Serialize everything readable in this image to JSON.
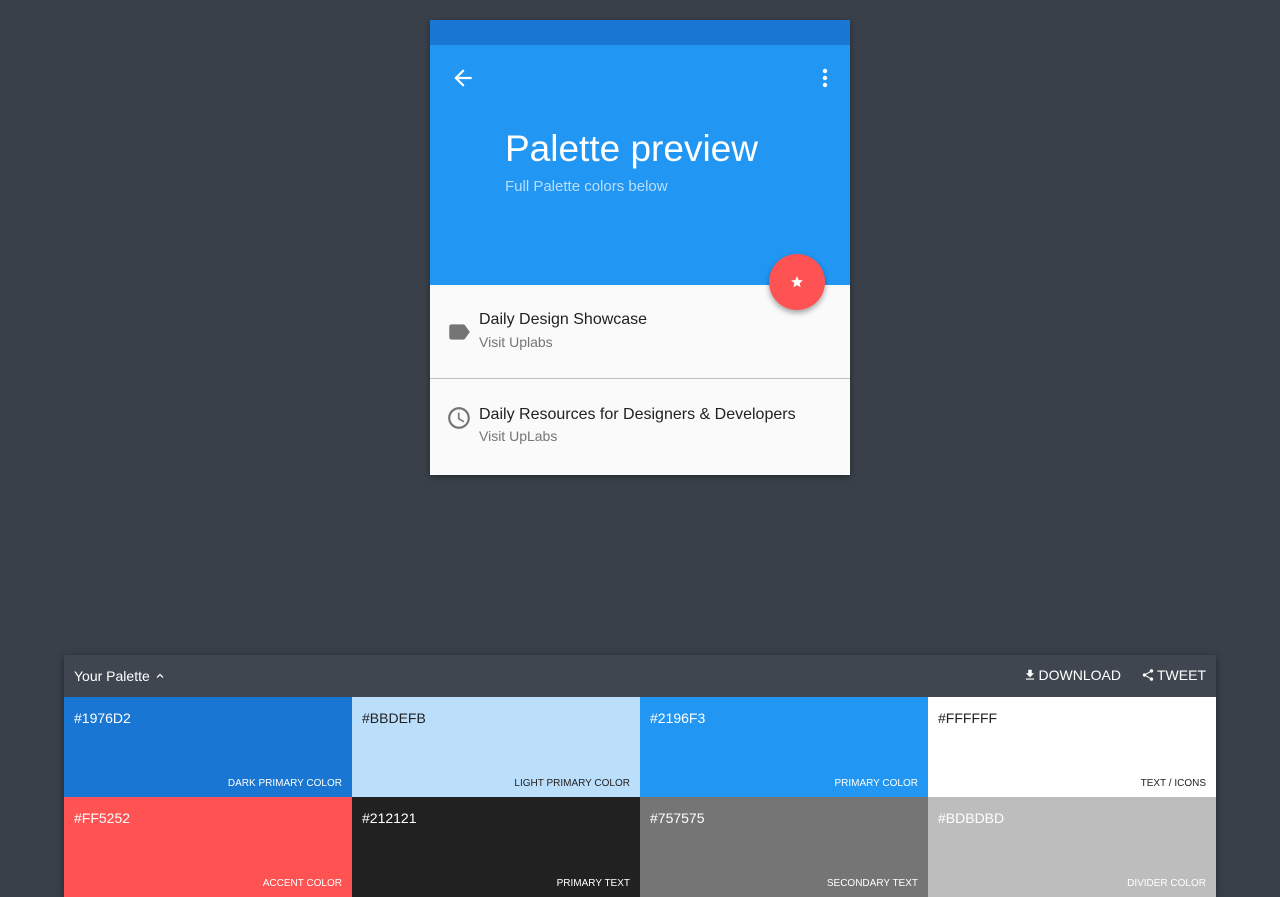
{
  "preview": {
    "title": "Palette preview",
    "subtitle": "Full Palette colors below",
    "back_icon": "arrow-back-icon",
    "menu_icon": "more-vert-icon",
    "fab_icon": "star-icon",
    "items": [
      {
        "primary": "Daily Design Showcase",
        "secondary": "Visit Uplabs",
        "icon": "label-icon"
      },
      {
        "primary": "Daily Resources for Designers & Developers",
        "secondary": "Visit UpLabs",
        "icon": "clock-icon"
      }
    ]
  },
  "palette": {
    "label": "Your Palette",
    "download_label": "DOWNLOAD",
    "tweet_label": "TWEET",
    "swatches": [
      {
        "hex": "#1976D2",
        "name": "DARK PRIMARY COLOR",
        "text_color": "#FFFFFF"
      },
      {
        "hex": "#BBDEFB",
        "name": "LIGHT PRIMARY COLOR",
        "text_color": "#212121"
      },
      {
        "hex": "#2196F3",
        "name": "PRIMARY COLOR",
        "text_color": "#FFFFFF"
      },
      {
        "hex": "#FFFFFF",
        "name": "TEXT / ICONS",
        "text_color": "#212121"
      },
      {
        "hex": "#FF5252",
        "name": "ACCENT COLOR",
        "text_color": "#FFFFFF"
      },
      {
        "hex": "#212121",
        "name": "PRIMARY TEXT",
        "text_color": "#FFFFFF"
      },
      {
        "hex": "#757575",
        "name": "SECONDARY TEXT",
        "text_color": "#FFFFFF"
      },
      {
        "hex": "#BDBDBD",
        "name": "DIVIDER COLOR",
        "text_color": "#FFFFFF"
      }
    ]
  }
}
